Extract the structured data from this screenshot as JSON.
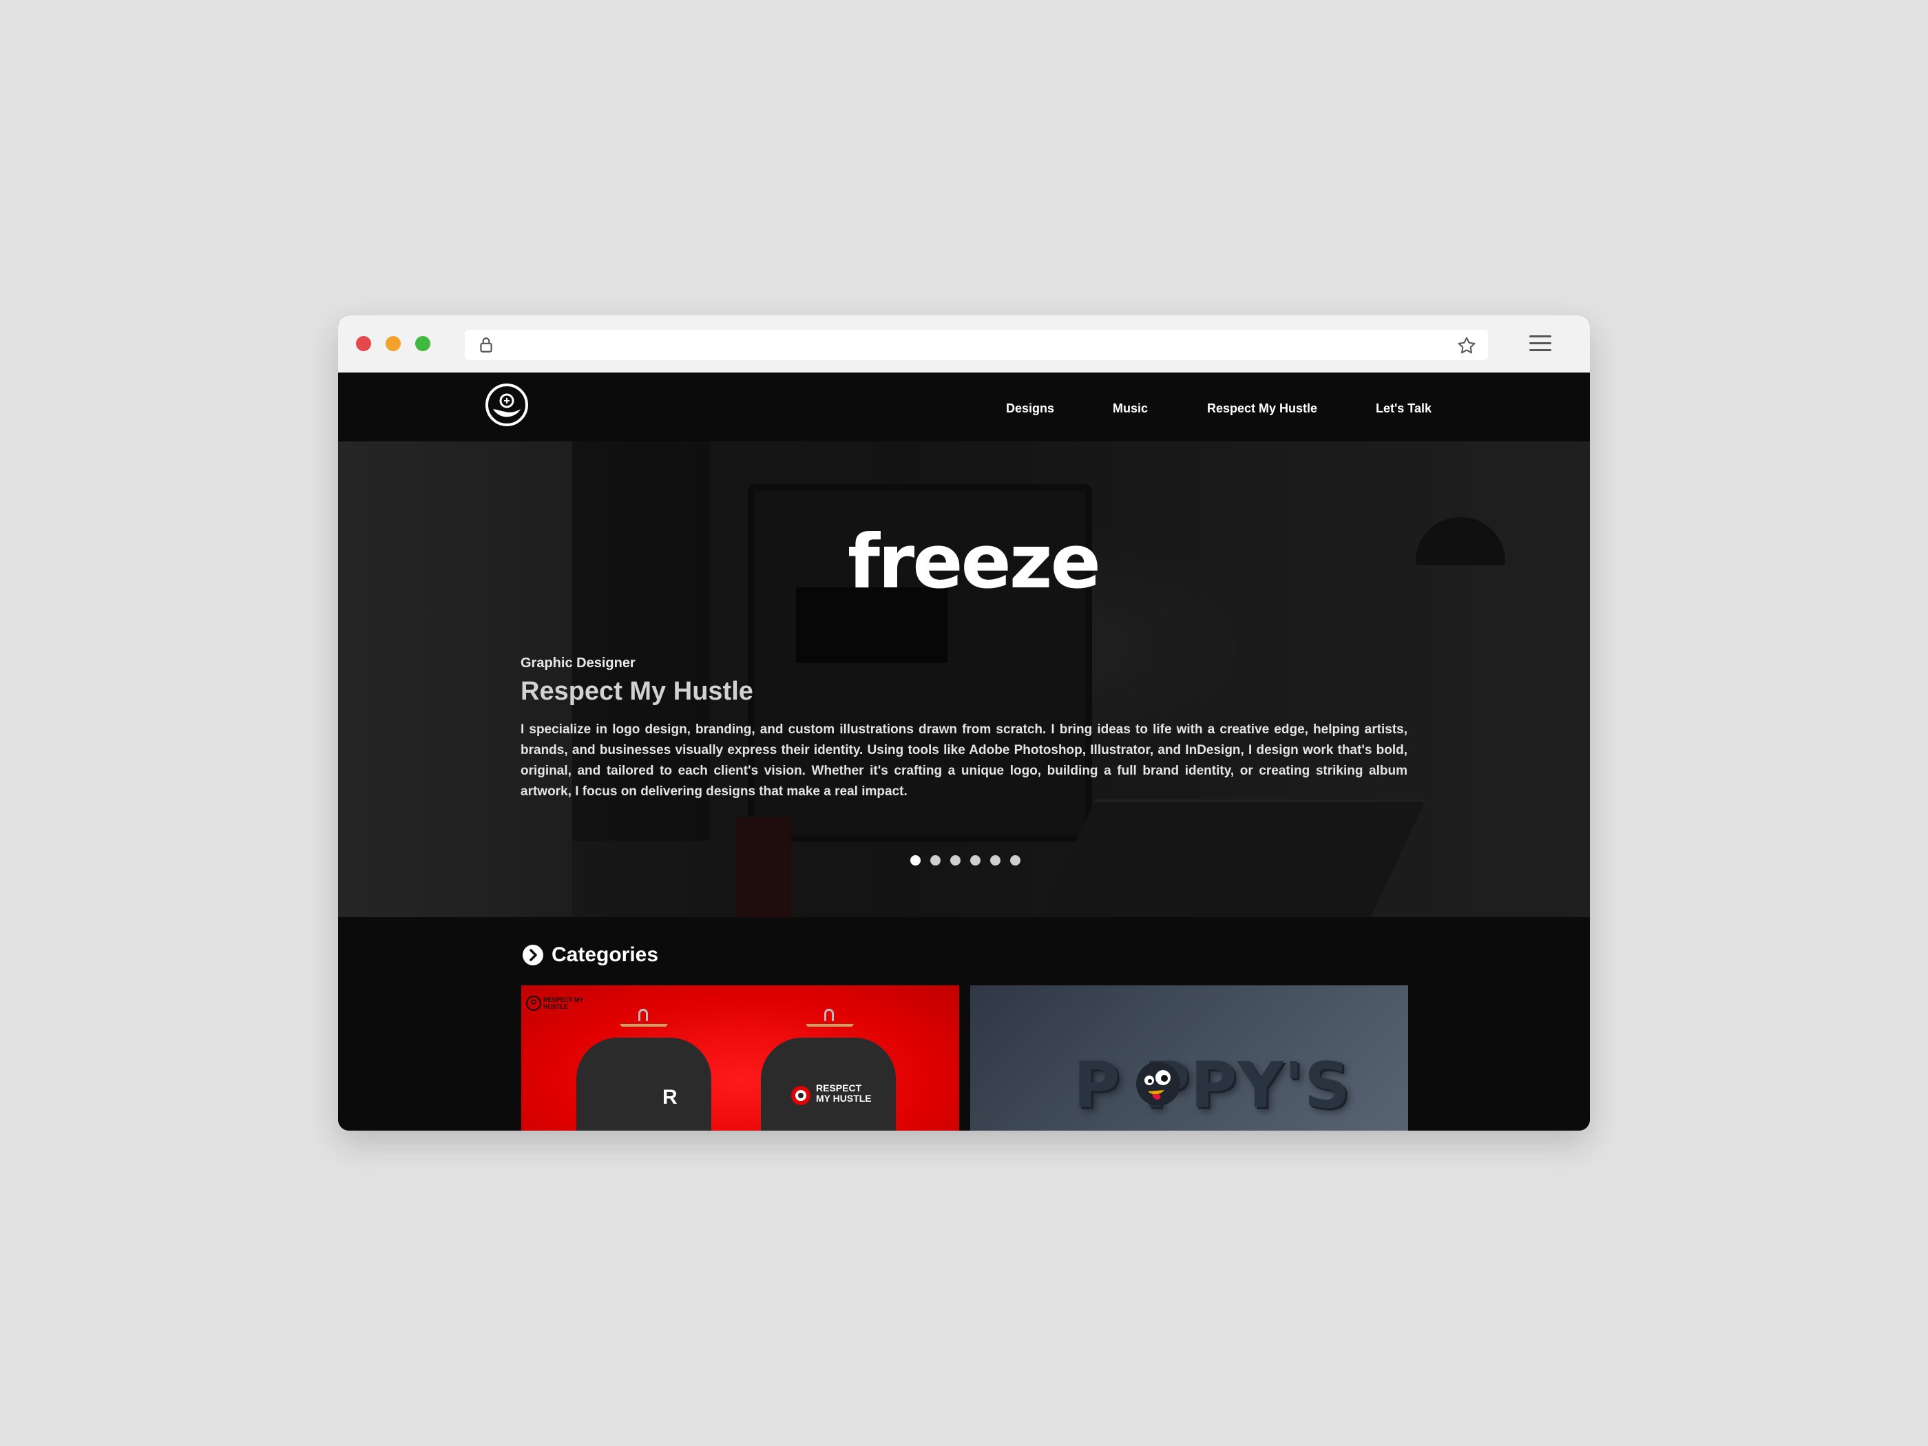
{
  "browser": {
    "traffic_lights": [
      "close",
      "minimize",
      "maximize"
    ],
    "colors": {
      "close": "#e5484d",
      "minimize": "#f2a22a",
      "maximize": "#3fb93f"
    }
  },
  "nav": {
    "links": [
      "Designs",
      "Music",
      "Respect My Hustle",
      "Let's Talk"
    ]
  },
  "hero": {
    "logo_word": "freeze",
    "role": "Graphic Designer",
    "title": "Respect My Hustle",
    "description": "I specialize in logo design, branding, and custom illustrations drawn from scratch. I bring ideas to life with a creative edge, helping artists, brands, and businesses visually express their identity. Using tools like Adobe Photoshop, Illustrator, and InDesign, I design work that's bold, original, and tailored to each client's vision. Whether it's crafting a unique logo, building a full brand identity, or creating striking album artwork, I focus on delivering designs that make a real impact.",
    "slider": {
      "total": 6,
      "active": 1
    }
  },
  "categories": {
    "title": "Categories",
    "cards": [
      {
        "name": "Respect My Hustle",
        "mini_brand": "RESPECT MY HUSTLE",
        "sweater_letter": "R",
        "sweater_brand": "RESPECT MY HUSTLE",
        "accent": "#e00000"
      },
      {
        "name": "Poppy's",
        "wordmark": "P  PPY'S",
        "accent": "#45505e"
      }
    ]
  }
}
